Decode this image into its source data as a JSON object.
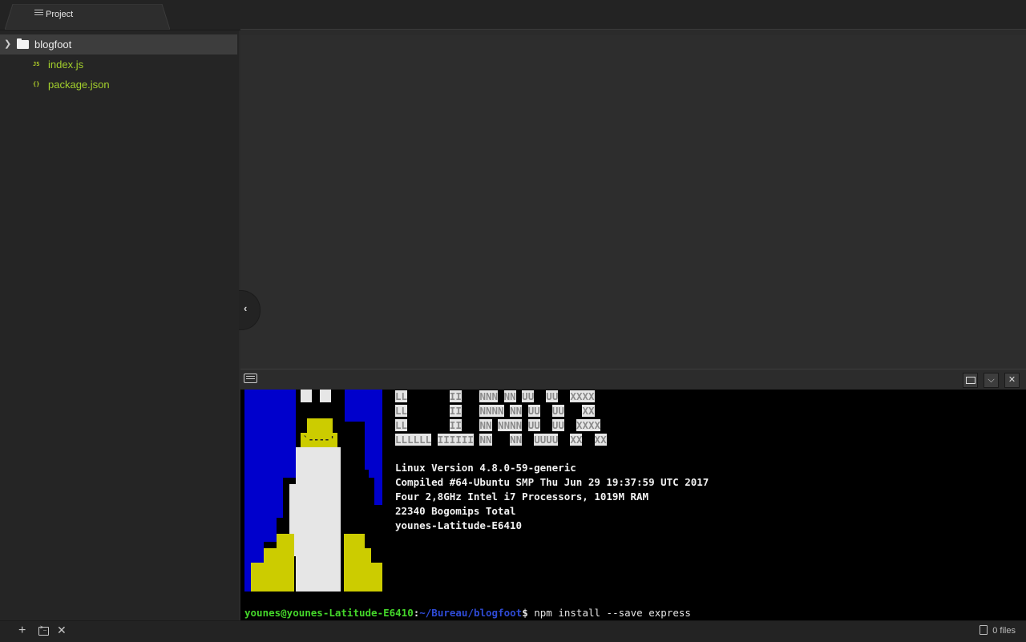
{
  "tabs": {
    "project_label": "Project"
  },
  "tree": {
    "root": {
      "label": "blogfoot",
      "expanded": true
    },
    "files": [
      {
        "badge": "JS",
        "label": "index.js",
        "icon": "js-file-icon"
      },
      {
        "badge": "{}",
        "label": "package.json",
        "icon": "json-file-icon"
      }
    ]
  },
  "footer": {
    "files_count": "0 files"
  },
  "terminal": {
    "logo_lines": [
      "LL       II   NNN NN UU  UU  XXXX",
      "LL       II   NNNN NN UU  UU   XX",
      "LL       II   NN NNNN UU  UU  XXXX",
      "LLLLLL IIIIII NN   NN  UUUU  XX  XX"
    ],
    "info_lines": [
      "Linux Version 4.8.0-59-generic",
      "Compiled #64-Ubuntu SMP Thu Jun 29 19:37:59 UTC 2017",
      "Four 2,8GHz Intel i7 Processors, 1019M RAM",
      "22340 Bogomips Total",
      "younes-Latitude-E6410"
    ],
    "beak_text": "`----'",
    "prompt": {
      "user": "younes@younes-Latitude-E6410",
      "colon": ":",
      "path": "~/Bureau/blogfoot",
      "sign": "$",
      "command": " npm install --save express"
    }
  },
  "colors": {
    "accent_file": "#a3d02c",
    "terminal_bg": "#000000",
    "tux_blue": "#0000cc",
    "tux_yellow": "#cccc00",
    "prompt_green": "#44d62a",
    "prompt_blue": "#2f4bd6"
  }
}
